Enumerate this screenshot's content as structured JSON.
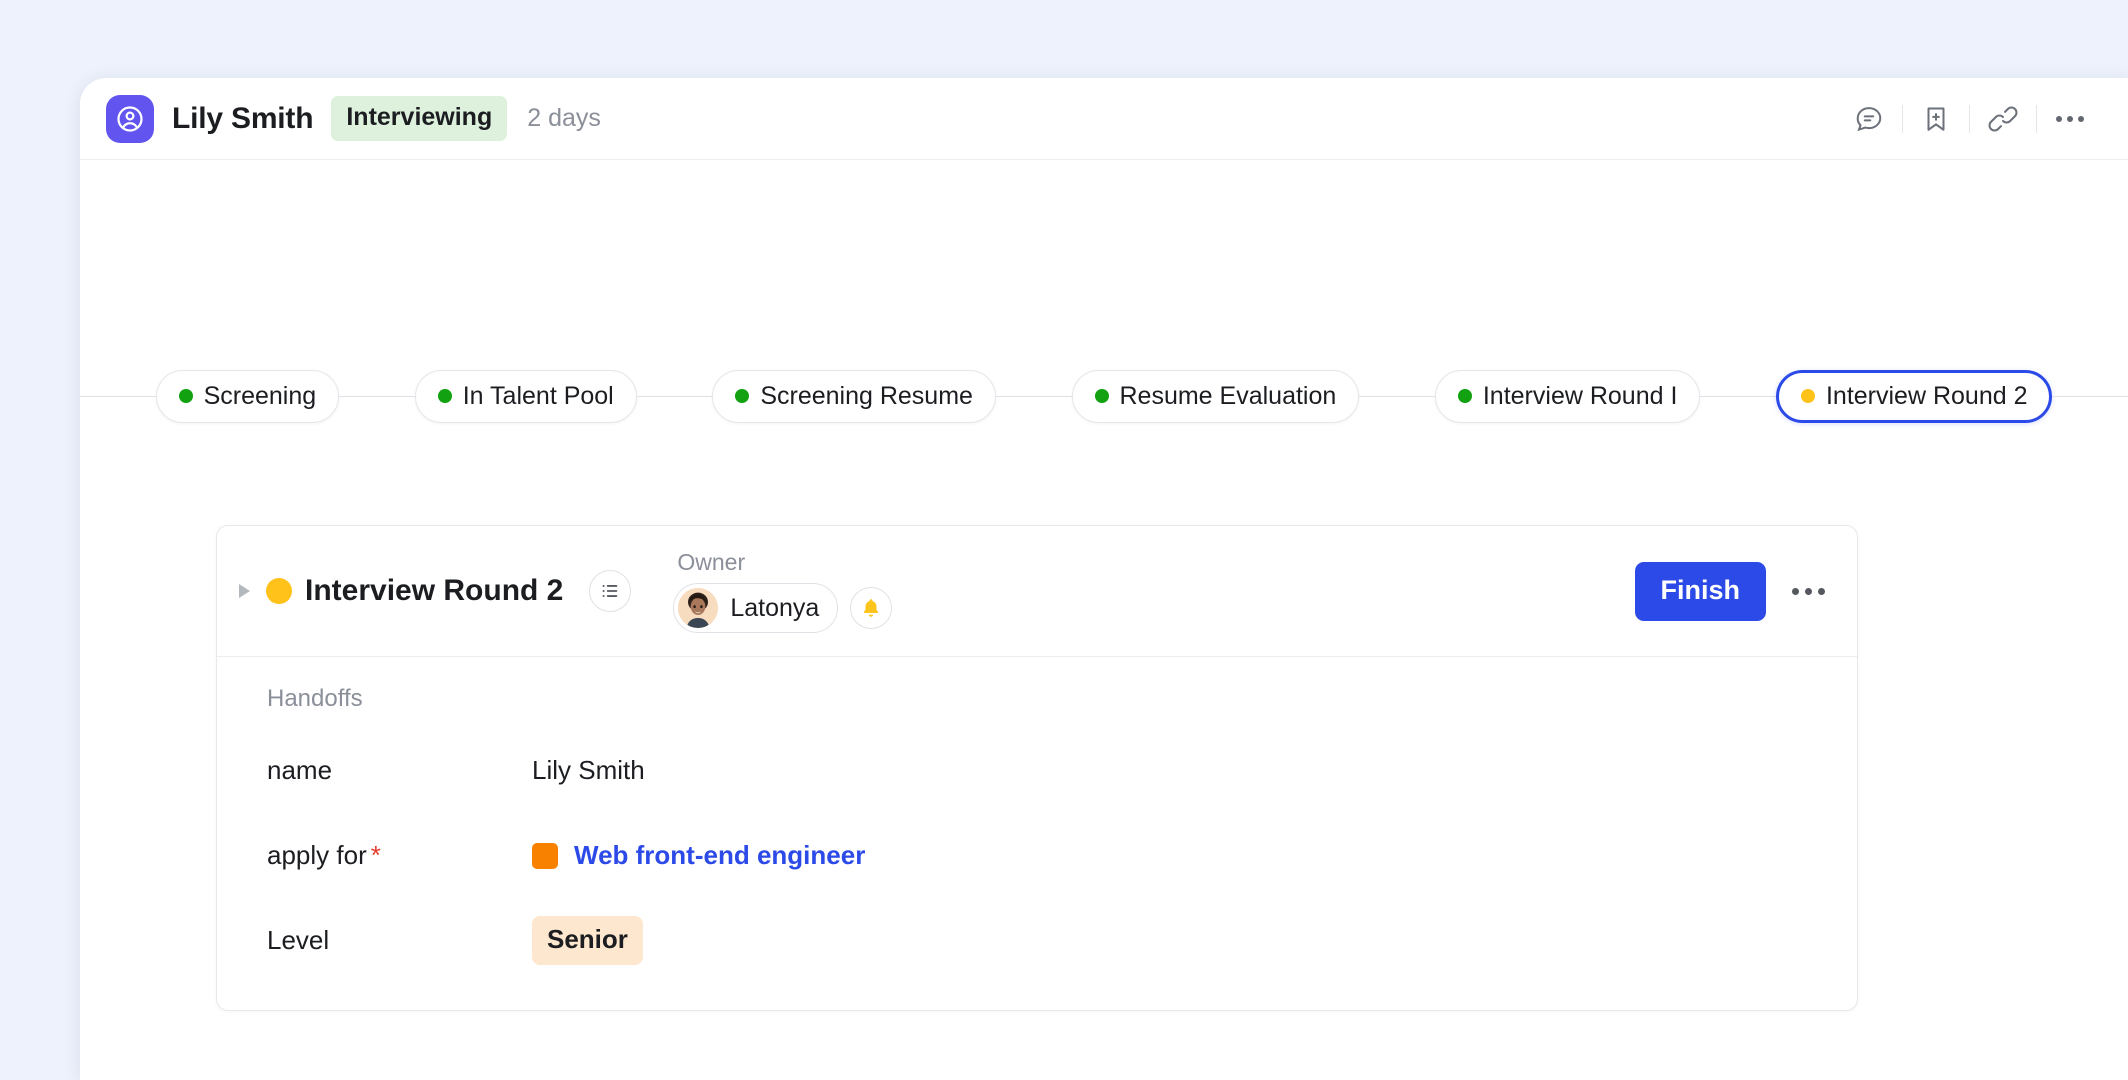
{
  "header": {
    "avatar_icon": "user-circle-icon",
    "title": "Lily Smith",
    "status": "Interviewing",
    "duration": "2 days",
    "actions": [
      {
        "name": "comment-icon",
        "label": "Comments"
      },
      {
        "name": "bookmark-add-icon",
        "label": "Save"
      },
      {
        "name": "link-icon",
        "label": "Copy link"
      },
      {
        "name": "more-icon",
        "label": "More"
      }
    ]
  },
  "pipeline": {
    "stages": [
      {
        "label": "Screening",
        "state": "done",
        "current": false
      },
      {
        "label": "In Talent Pool",
        "state": "done",
        "current": false
      },
      {
        "label": "Screening Resume",
        "state": "done",
        "current": false
      },
      {
        "label": "Resume Evaluation",
        "state": "done",
        "current": false
      },
      {
        "label": "Interview Round I",
        "state": "done",
        "current": false
      },
      {
        "label": "Interview Round 2",
        "state": "active",
        "current": true
      }
    ],
    "colors": {
      "done": "#11a111",
      "active": "#ffc21a",
      "current_border": "#2c4ae8"
    }
  },
  "card": {
    "title": "Interview Round 2",
    "status_color": "#ffc21a",
    "list_icon": "list-icon",
    "owner_label": "Owner",
    "owner_name": "Latonya",
    "bell_icon": "bell-icon",
    "finish_label": "Finish",
    "more_icon": "more-icon",
    "section_label": "Handoffs",
    "fields": [
      {
        "label": "name",
        "required": false,
        "type": "text",
        "value": "Lily Smith"
      },
      {
        "label": "apply for",
        "required": true,
        "type": "link",
        "value": "Web front-end engineer",
        "swatch_color": "#f88100",
        "link_color": "#2c4ae8"
      },
      {
        "label": "Level",
        "required": false,
        "type": "tag",
        "value": "Senior",
        "tag_bg": "#fde7cf"
      }
    ]
  },
  "theme": {
    "backdrop": "#eef2fc",
    "panel": "#ffffff",
    "accent": "#2c4ae8",
    "brand_purple": "#6254ef",
    "status_green_bg": "#ddf1dd",
    "required_red": "#e83b2f"
  }
}
